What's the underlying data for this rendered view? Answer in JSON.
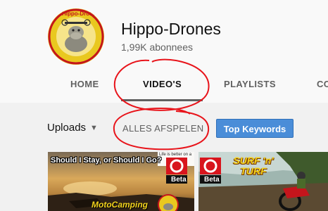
{
  "channel": {
    "name": "Hippo-Drones",
    "subscribers": "1,99K abonnees",
    "avatar_text": "Hippo-Drones"
  },
  "tabs": [
    {
      "label": "HOME",
      "active": false
    },
    {
      "label": "VIDEO'S",
      "active": true
    },
    {
      "label": "PLAYLISTS",
      "active": false
    },
    {
      "label": "CO",
      "active": false
    }
  ],
  "toolbar": {
    "uploads_label": "Uploads",
    "uploads_icon": "caret-down-icon",
    "play_all_label": "ALLES AFSPELEN",
    "keywords_button": "Top Keywords"
  },
  "videos": [
    {
      "title_overlay": "Should I Stay, or Should I Go?",
      "subtitle_overlay": "MotoCamping",
      "brand_text": "Beta",
      "corner_text": "Life is better on a"
    },
    {
      "title_overlay": "SURF 'n' TURF",
      "brand_text": "Beta"
    }
  ],
  "colors": {
    "header_bg": "#f9f9f9",
    "page_bg": "#f1f1f1",
    "keywords_button": "#4a8dd8",
    "annotation_red": "#e8141b",
    "avatar_yellow": "#e9c81f"
  }
}
